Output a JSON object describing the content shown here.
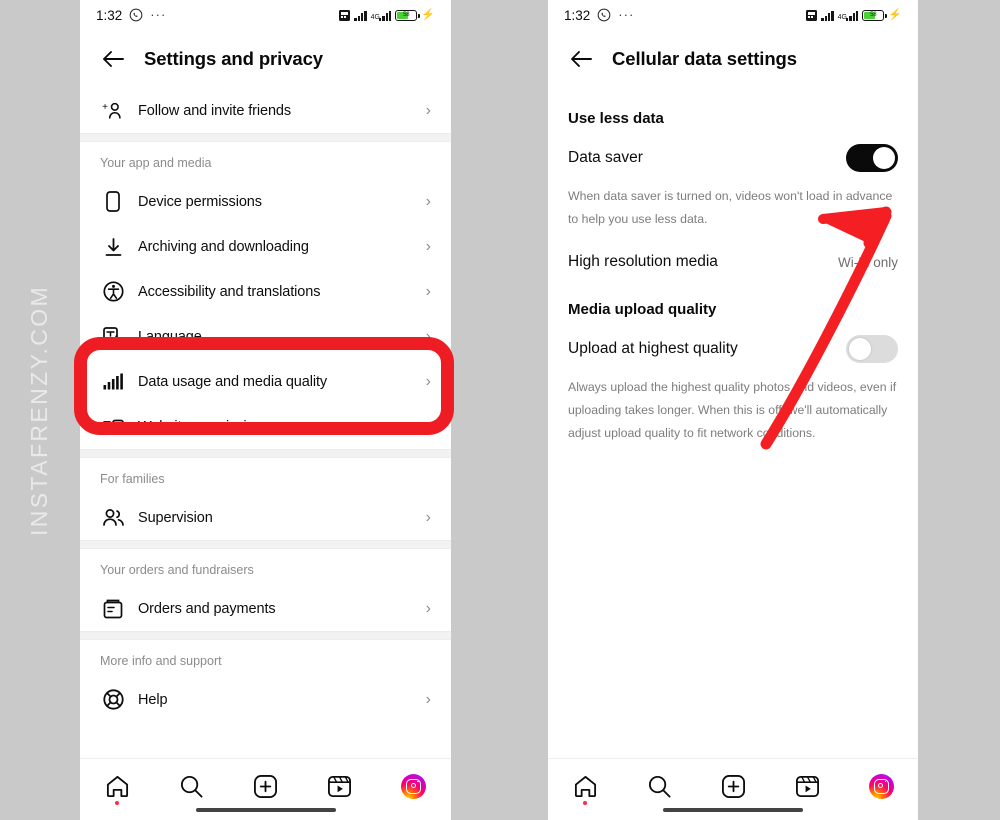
{
  "watermark": {
    "text": "INSTAFRENZY.COM"
  },
  "status_bar": {
    "time": "1:32",
    "whatsapp_icon": "whatsapp-icon",
    "overflow_dots": "···",
    "network_label": "4G",
    "battery_percent": "58",
    "charging": true
  },
  "colors": {
    "annotation_red": "#ee1d23",
    "toggle_on": "#0a0a0a",
    "toggle_off": "#dcdcdc",
    "battery_green": "#4cd137",
    "badge_red": "#ff2e4d",
    "backdrop_gray": "#c9c9c9"
  },
  "left_phone": {
    "header": {
      "back_label": "←",
      "title": "Settings and privacy"
    },
    "top_row": {
      "label": "Follow and invite friends",
      "icon": "add-person-icon",
      "chevron": "›"
    },
    "sections": [
      {
        "title": "Your app and media",
        "items": [
          {
            "label": "Device permissions",
            "icon": "phone-icon",
            "chevron": "›"
          },
          {
            "label": "Archiving and downloading",
            "icon": "download-icon",
            "chevron": "›"
          },
          {
            "label": "Accessibility and translations",
            "icon": "accessibility-icon",
            "chevron": "›"
          },
          {
            "label": "Language",
            "icon": "language-icon",
            "chevron": "›"
          },
          {
            "label": "Data usage and media quality",
            "icon": "signal-bars-icon",
            "chevron": "›"
          },
          {
            "label": "Website permissions",
            "icon": "website-icon",
            "chevron": "›"
          }
        ]
      },
      {
        "title": "For families",
        "items": [
          {
            "label": "Supervision",
            "icon": "people-icon",
            "chevron": "›"
          }
        ]
      },
      {
        "title": "Your orders and fundraisers",
        "items": [
          {
            "label": "Orders and payments",
            "icon": "receipt-icon",
            "chevron": "›"
          }
        ]
      },
      {
        "title": "More info and support",
        "items": [
          {
            "label": "Help",
            "icon": "lifebuoy-icon",
            "chevron": "›"
          }
        ]
      }
    ],
    "highlight": {
      "target_label": "Data usage and media quality",
      "shape": "rounded-rectangle"
    }
  },
  "right_phone": {
    "header": {
      "back_label": "←",
      "title": "Cellular data settings"
    },
    "sections": [
      {
        "title": "Use less data",
        "rows": [
          {
            "label": "Data saver",
            "control": "toggle",
            "state": "on",
            "description": "When data saver is turned on, videos won't load in advance to help you use less data."
          },
          {
            "label": "High resolution media",
            "control": "value",
            "value": "Wi-Fi only"
          }
        ]
      },
      {
        "title": "Media upload quality",
        "rows": [
          {
            "label": "Upload at highest quality",
            "control": "toggle",
            "state": "off",
            "description": "Always upload the highest quality photos and videos, even if uploading takes longer. When this is off, we'll automatically adjust upload quality to fit network conditions."
          }
        ]
      }
    ],
    "annotation": {
      "type": "arrow",
      "points_to": "Data saver toggle"
    }
  },
  "bottom_nav": {
    "items": [
      {
        "name": "home",
        "icon": "home-icon",
        "badge": true
      },
      {
        "name": "search",
        "icon": "search-icon",
        "badge": false
      },
      {
        "name": "create",
        "icon": "plus-square-icon",
        "badge": false
      },
      {
        "name": "reels",
        "icon": "reels-icon",
        "badge": false
      },
      {
        "name": "profile",
        "icon": "instagram-avatar-icon",
        "badge": false
      }
    ]
  }
}
